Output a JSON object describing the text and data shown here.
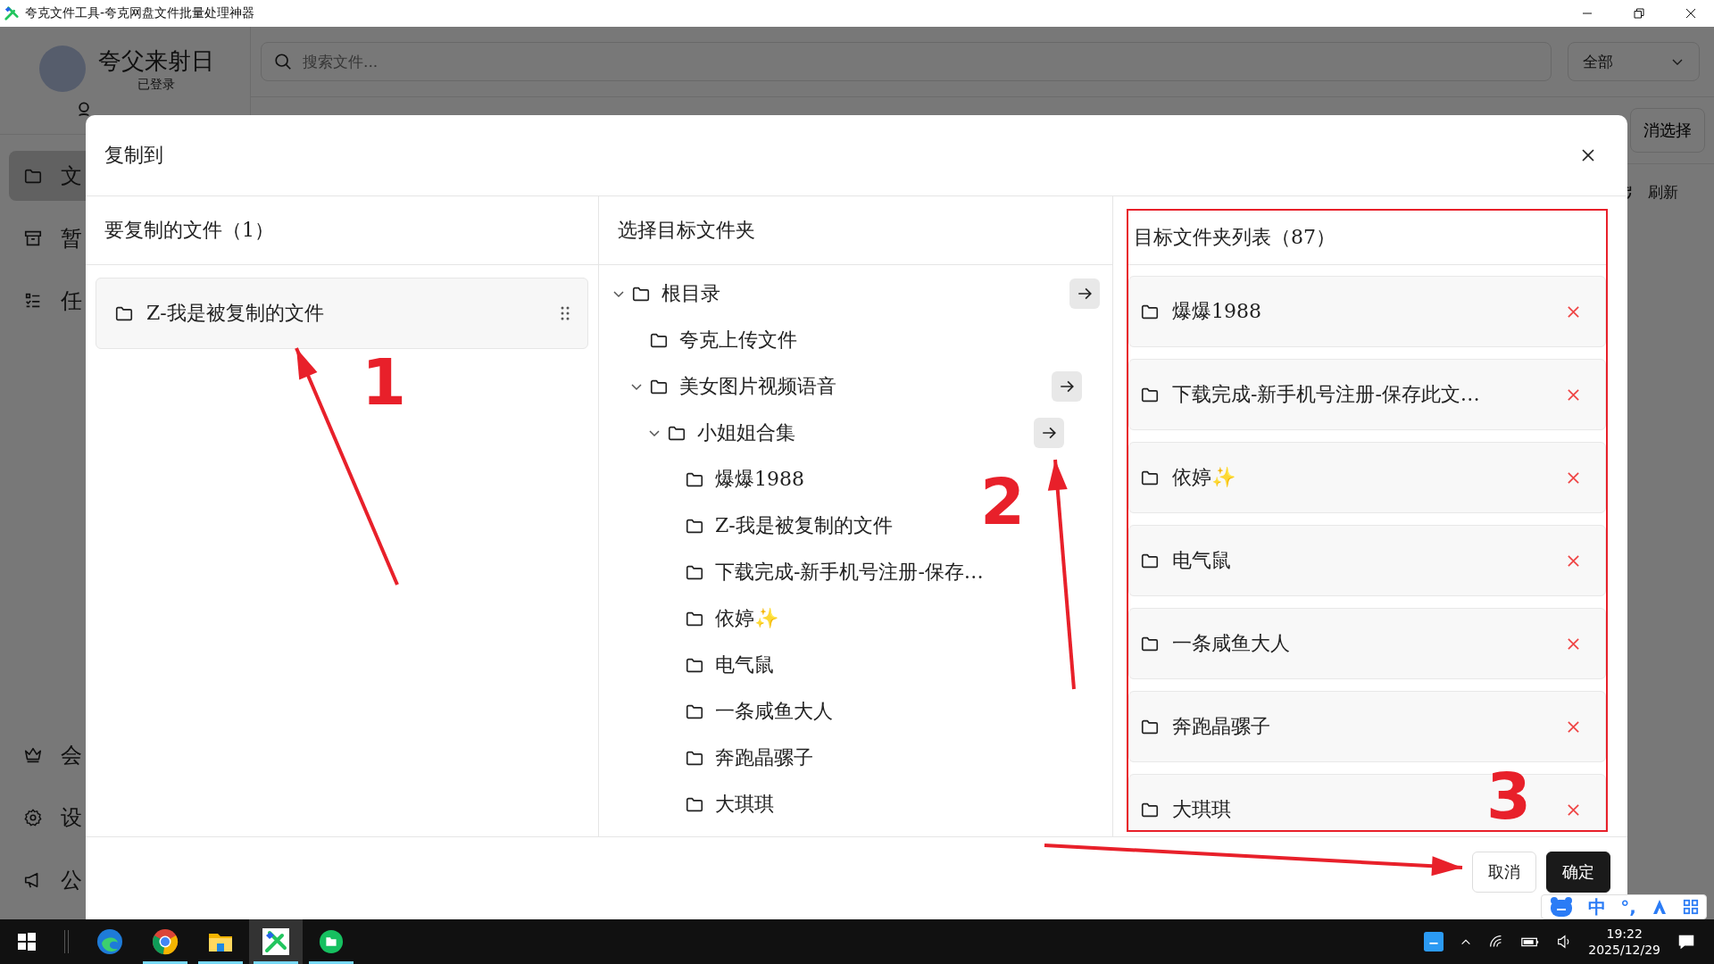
{
  "window": {
    "title": "夸克文件工具-夸克网盘文件批量处理神器"
  },
  "user": {
    "name": "夸父来射日",
    "status": "已登录"
  },
  "sidebar": {
    "items": [
      {
        "kind": "files",
        "label": "文",
        "selected": true
      },
      {
        "kind": "archive",
        "label": "暂",
        "selected": false
      },
      {
        "kind": "tasks",
        "label": "任",
        "selected": false
      }
    ],
    "bottom_items": [
      {
        "kind": "vip",
        "label": "会"
      },
      {
        "kind": "settings",
        "label": "设"
      },
      {
        "kind": "notice",
        "label": "公"
      }
    ]
  },
  "search": {
    "placeholder": "搜索文件..."
  },
  "filter": {
    "value": "全部"
  },
  "toolbar": {
    "deselect": "消选择",
    "refresh": "刷新"
  },
  "dialog": {
    "title": "复制到",
    "source": {
      "heading": "要复制的文件（1）",
      "files": [
        "Z-我是被复制的文件"
      ]
    },
    "tree": {
      "heading": "选择目标文件夹",
      "nodes": [
        {
          "label": "根目录",
          "expanded": true,
          "children": [
            {
              "label": "夸克上传文件"
            },
            {
              "label": "美女图片视频语音",
              "expanded": true,
              "children": [
                {
                  "label": "小姐姐合集",
                  "expanded": true,
                  "children": [
                    {
                      "label": "爆爆1988"
                    },
                    {
                      "label": "Z-我是被复制的文件"
                    },
                    {
                      "label": "下载完成-新手机号注册-保存…"
                    },
                    {
                      "label": "依婷✨"
                    },
                    {
                      "label": "电气鼠"
                    },
                    {
                      "label": "一条咸鱼大人"
                    },
                    {
                      "label": "奔跑晶骡子"
                    },
                    {
                      "label": "大琪琪"
                    }
                  ]
                }
              ]
            }
          ]
        }
      ]
    },
    "targets": {
      "heading": "目标文件夹列表（87）",
      "items": [
        "爆爆1988",
        "下载完成-新手机号注册-保存此文…",
        "依婷✨",
        "电气鼠",
        "一条咸鱼大人",
        "奔跑晶骡子",
        "大琪琪"
      ]
    },
    "buttons": {
      "cancel": "取消",
      "confirm": "确定"
    }
  },
  "annotations": [
    {
      "label": "1"
    },
    {
      "label": "2"
    },
    {
      "label": "3"
    }
  ],
  "ime": {
    "mode": "中",
    "punct": "°,"
  },
  "taskbar": {
    "apps": [
      {
        "kind": "edge",
        "running": false,
        "selected": false
      },
      {
        "kind": "chrome",
        "running": true,
        "selected": false
      },
      {
        "kind": "explorer",
        "running": true,
        "selected": false
      },
      {
        "kind": "tool",
        "running": true,
        "selected": true
      },
      {
        "kind": "green",
        "running": true,
        "selected": false
      }
    ],
    "time": "19:22",
    "date": "2025/12/29"
  }
}
